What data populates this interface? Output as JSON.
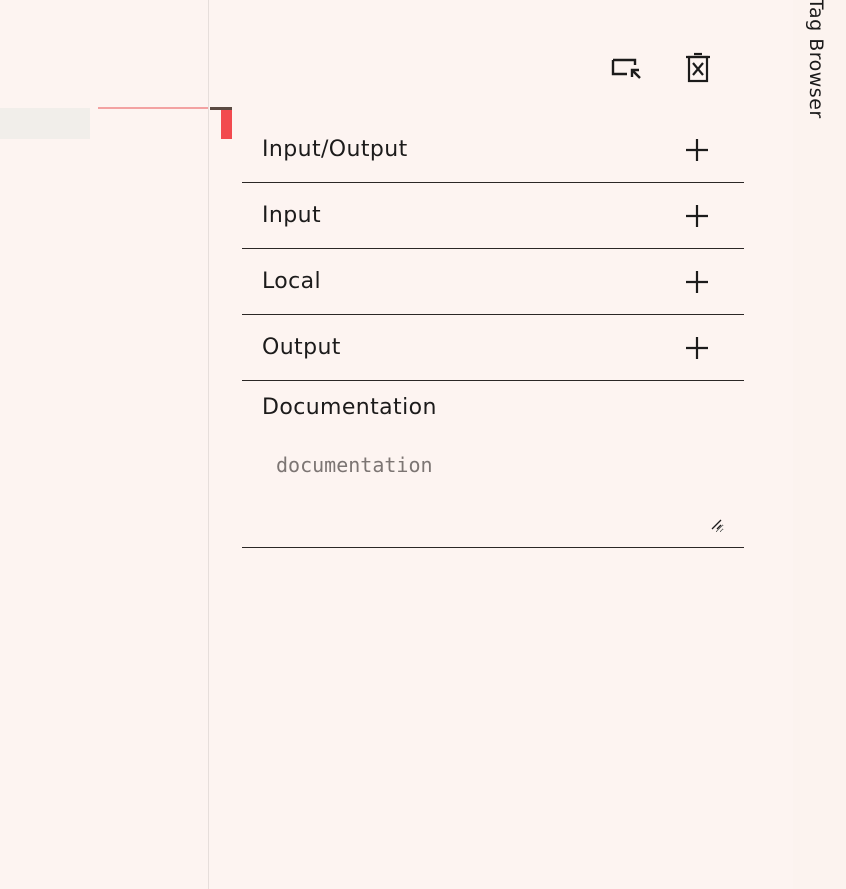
{
  "toolbar": {
    "move_icon": "move-to-window-icon",
    "delete_icon": "delete-document-icon"
  },
  "sections": [
    {
      "label": "Input/Output",
      "add_icon": "plus-icon"
    },
    {
      "label": "Input",
      "add_icon": "plus-icon"
    },
    {
      "label": "Local",
      "add_icon": "plus-icon"
    },
    {
      "label": "Output",
      "add_icon": "plus-icon"
    }
  ],
  "documentation": {
    "label": "Documentation",
    "value": "",
    "placeholder": "documentation"
  },
  "side_tab": {
    "label": "Tag Browser"
  },
  "colors": {
    "background": "#fdf4f1",
    "accent_red": "#f24a4f",
    "text": "#1c1b1b"
  }
}
